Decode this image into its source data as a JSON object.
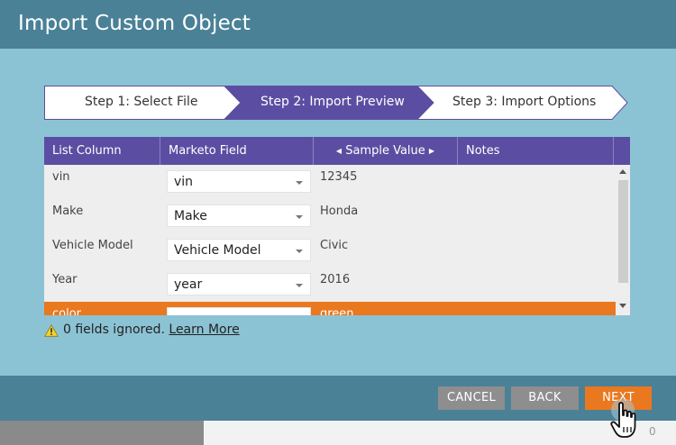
{
  "dialog": {
    "title": "Import Custom Object"
  },
  "steps": [
    {
      "label": "Step 1: Select File",
      "active": false
    },
    {
      "label": "Step 2: Import Preview",
      "active": true
    },
    {
      "label": "Step 3: Import Options",
      "active": false
    }
  ],
  "table": {
    "headers": {
      "list_column": "List Column",
      "marketo_field": "Marketo Field",
      "sample_value": "Sample Value",
      "notes": "Notes"
    },
    "rows": [
      {
        "list_column": "vin",
        "marketo_field": "vin",
        "sample_value": "12345",
        "notes": ""
      },
      {
        "list_column": "Make",
        "marketo_field": "Make",
        "sample_value": "Honda",
        "notes": ""
      },
      {
        "list_column": "Vehicle Model",
        "marketo_field": "Vehicle Model",
        "sample_value": "Civic",
        "notes": ""
      },
      {
        "list_column": "Year",
        "marketo_field": "year",
        "sample_value": "2016",
        "notes": ""
      },
      {
        "list_column": "color",
        "marketo_field": "",
        "sample_value": "green",
        "notes": "",
        "selected": true
      }
    ]
  },
  "status": {
    "message": "0 fields ignored.",
    "link": "Learn More"
  },
  "footer": {
    "cancel": "CANCEL",
    "back": "BACK",
    "next": "NEXT"
  },
  "background": {
    "counter": "0"
  },
  "colors": {
    "header": "#4a8196",
    "body": "#8cc3d4",
    "active_step": "#5b4ea2",
    "accent": "#e9781f"
  }
}
